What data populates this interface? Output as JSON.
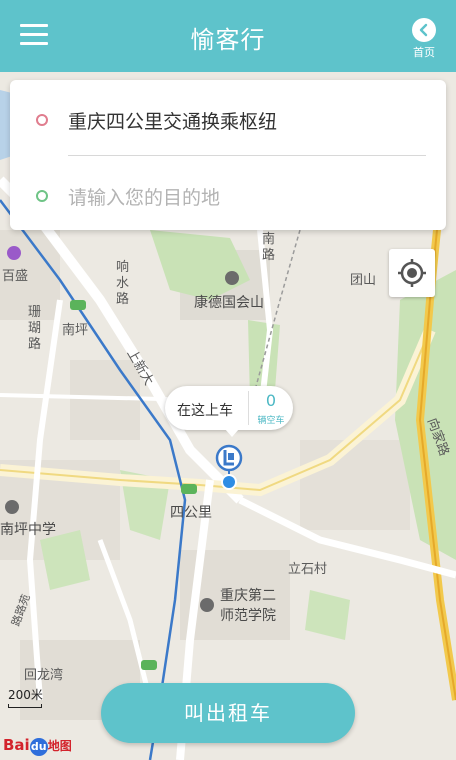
{
  "header": {
    "title": "愉客行",
    "home_label": "首页"
  },
  "search": {
    "start_location": "重庆四公里交通换乘枢纽",
    "destination_placeholder": "请输入您的目的地"
  },
  "pickup_bubble": {
    "label": "在这上车",
    "count": "0",
    "unit": "辆空车"
  },
  "map": {
    "labels": {
      "baisheng": "百盛",
      "xiangshui_road": "响水路",
      "shanhu_road": "珊瑚路",
      "nanping": "南坪",
      "kangde": "康德国会山",
      "tuanshan": "团山",
      "nan_road": "南路",
      "upper_road": "上新大",
      "xiangjia_road": "向家路",
      "sigongli": "四公里",
      "nanping_middle_school": "南坪中学",
      "lishi_village": "立石村",
      "chongqing_normal": "重庆第二",
      "chongqing_normal_2": "师范学院",
      "huilongwan": "回龙湾",
      "lulu_road": "路路苑"
    },
    "scale": "200米",
    "logo": {
      "part1": "Bai",
      "part2": "du",
      "part3": "地图"
    }
  },
  "actions": {
    "call_taxi": "叫出租车"
  },
  "colors": {
    "primary": "#5ec3cb",
    "start_dot": "#e07d8e",
    "dest_dot": "#6fc486"
  }
}
